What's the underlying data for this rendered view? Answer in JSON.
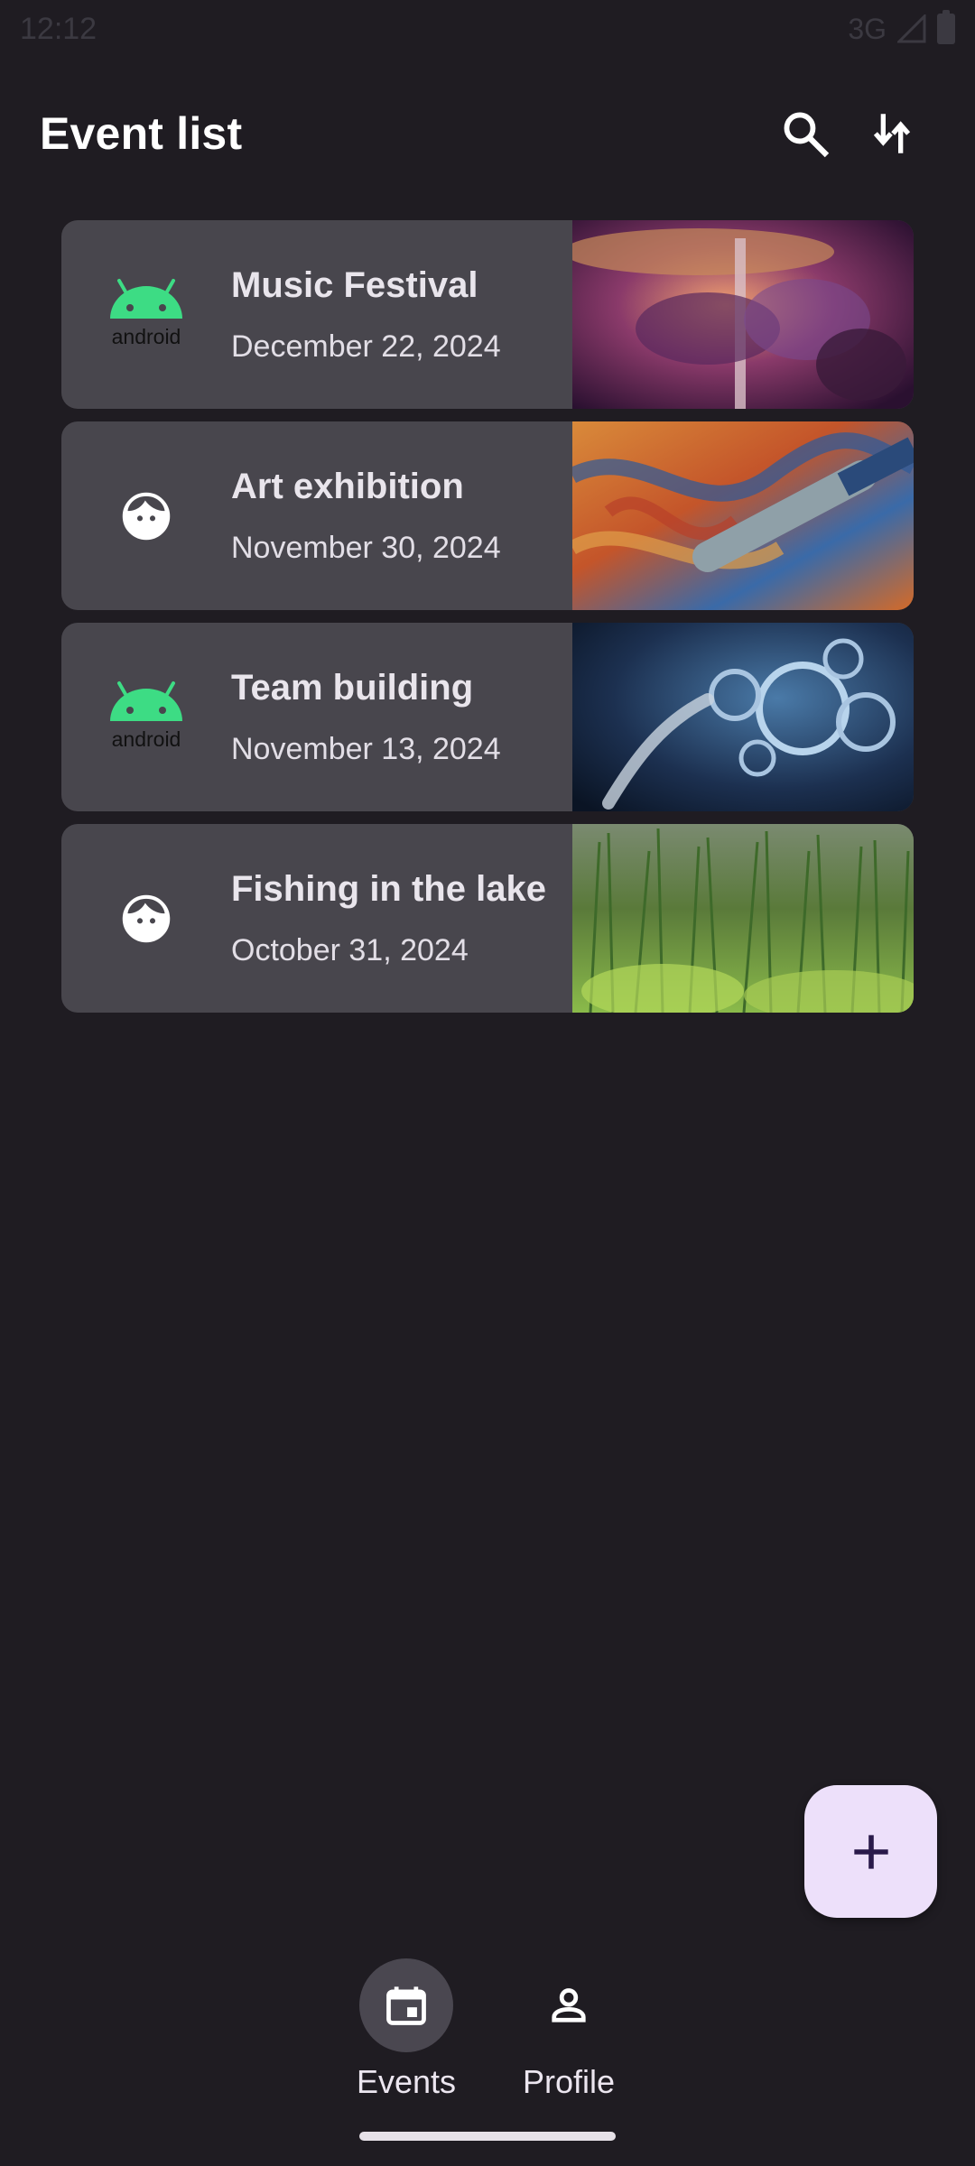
{
  "status_bar": {
    "time": "12:12",
    "network": "3G",
    "icons": [
      "signal-icon",
      "battery-icon"
    ]
  },
  "header": {
    "title": "Event list",
    "actions": [
      {
        "name": "search-icon"
      },
      {
        "name": "sort-icon"
      }
    ]
  },
  "events": [
    {
      "title": "Music Festival",
      "date": "December 22, 2024",
      "lead_icon": "android-logo-icon",
      "image": "drum-kit-photo"
    },
    {
      "title": "Art exhibition",
      "date": "November 30, 2024",
      "lead_icon": "face-icon",
      "image": "paintbrush-photo"
    },
    {
      "title": "Team building",
      "date": "November 13, 2024",
      "lead_icon": "android-logo-icon",
      "image": "gears-competence-photo"
    },
    {
      "title": "Fishing in the lake",
      "date": "October 31, 2024",
      "lead_icon": "face-icon",
      "image": "lake-reeds-photo"
    }
  ],
  "fab": {
    "icon": "plus-icon"
  },
  "bottom_nav": {
    "items": [
      {
        "label": "Events",
        "icon": "calendar-icon",
        "active": true
      },
      {
        "label": "Profile",
        "icon": "person-icon",
        "active": false
      }
    ]
  },
  "colors": {
    "background": "#1f1c22",
    "card": "#48464d",
    "fab": "#ede0fa",
    "android_green": "#3ddc84"
  }
}
